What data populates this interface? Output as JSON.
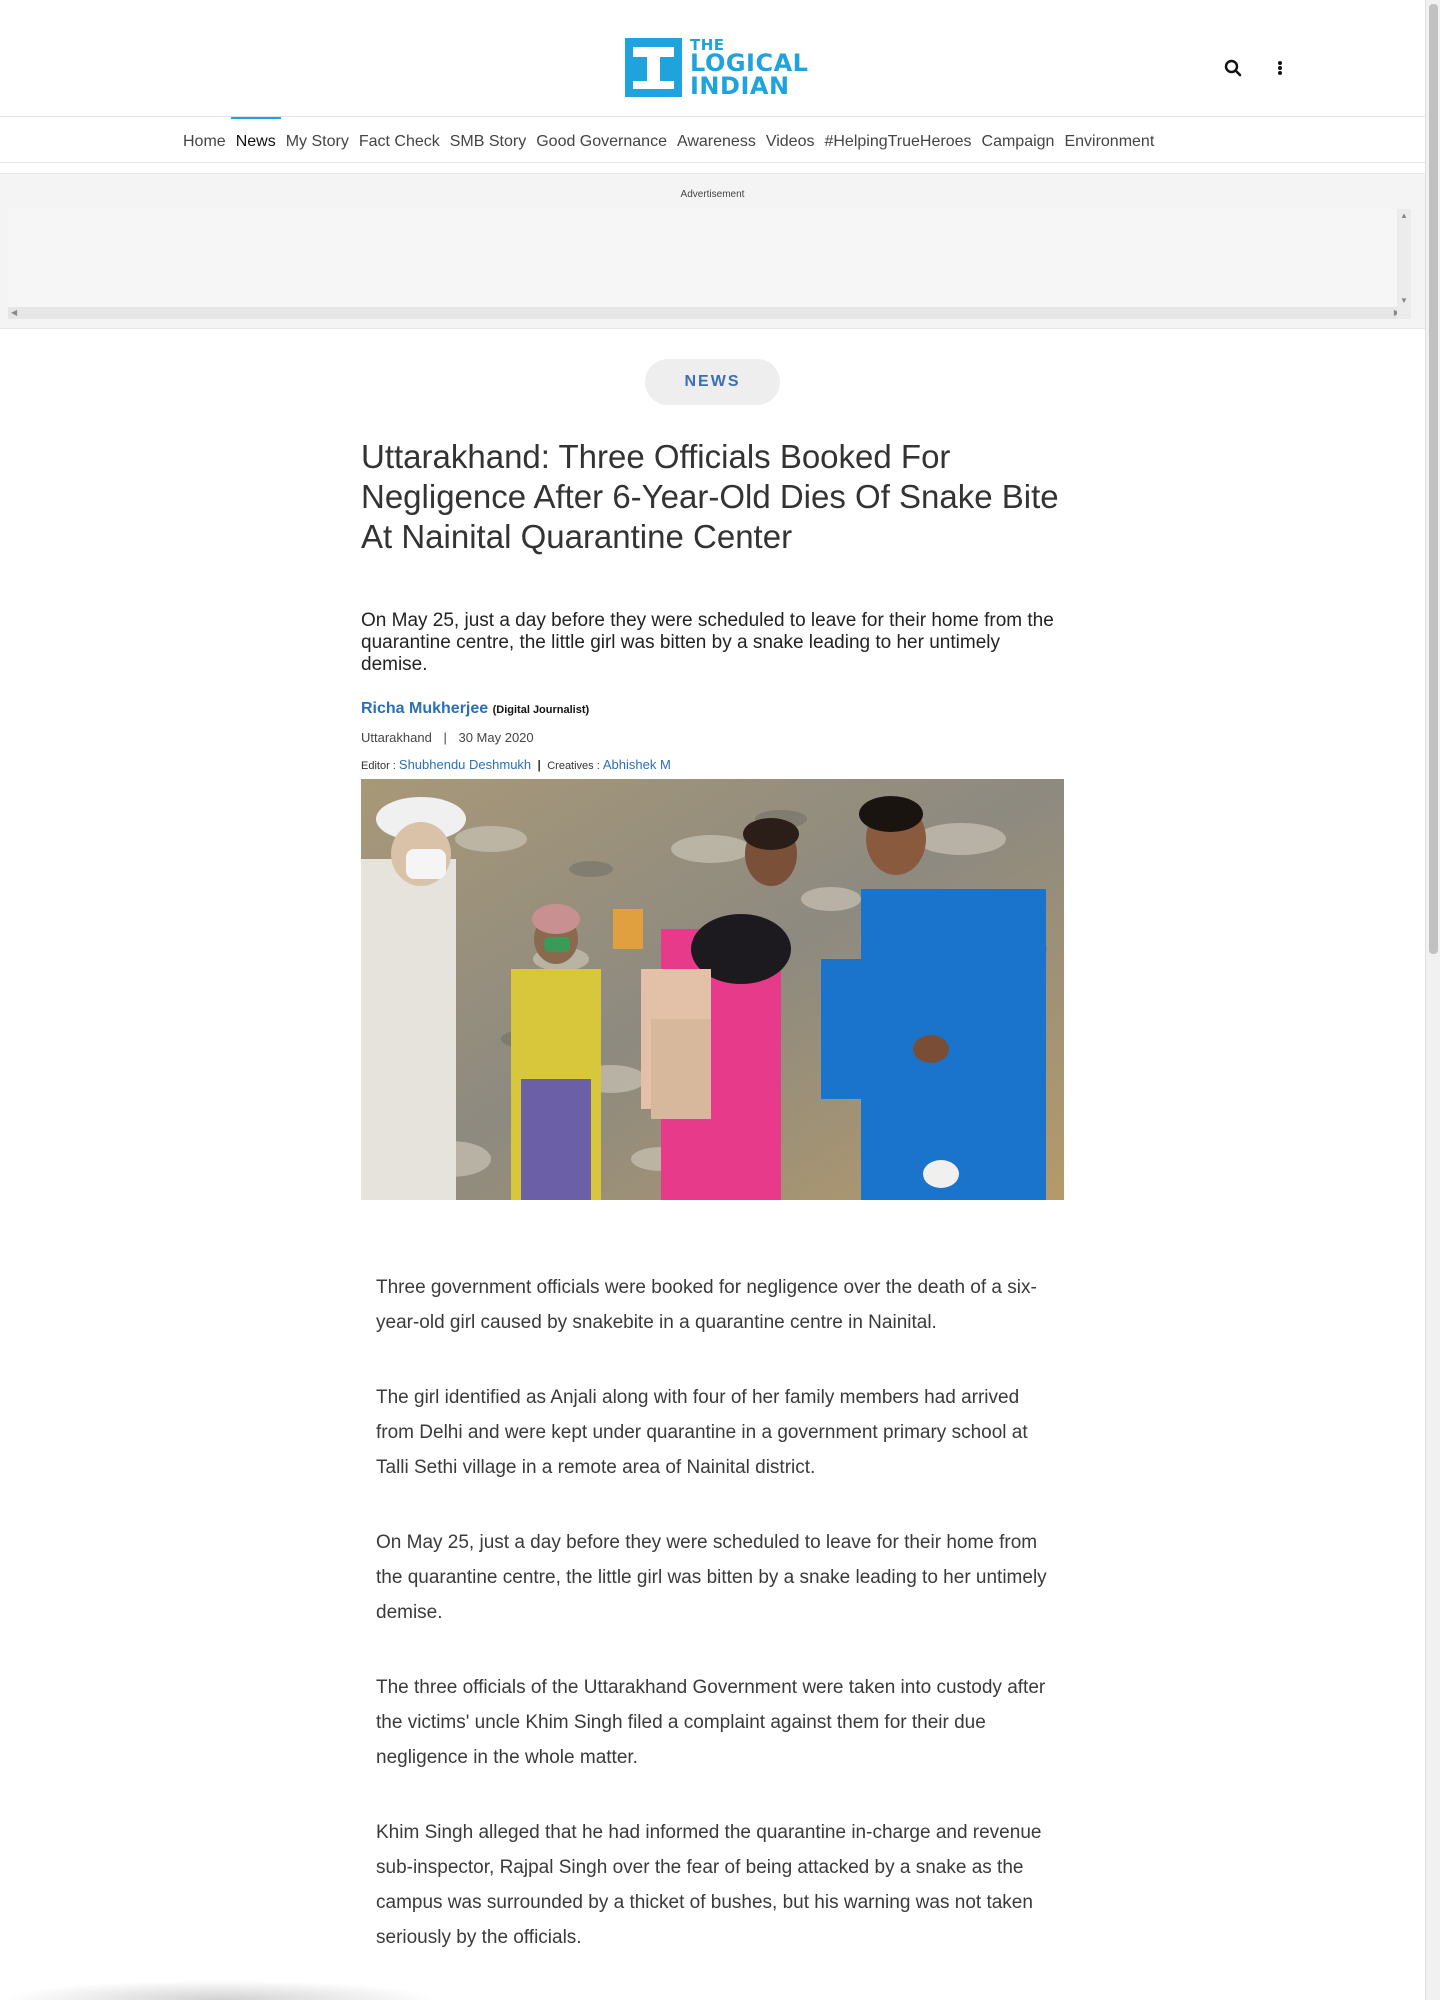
{
  "brand": {
    "logo_line1": "THE",
    "logo_line2": "LOGICAL",
    "logo_line3": "INDIAN",
    "color": "#1fa3dc"
  },
  "header": {
    "search_icon": "search-icon",
    "more_icon": "more-vertical-icon"
  },
  "nav": {
    "items": [
      {
        "label": "Home"
      },
      {
        "label": "News"
      },
      {
        "label": "My Story"
      },
      {
        "label": "Fact Check"
      },
      {
        "label": "SMB Story"
      },
      {
        "label": "Good Governance"
      },
      {
        "label": "Awareness"
      },
      {
        "label": "Videos"
      },
      {
        "label": "#HelpingTrueHeroes"
      },
      {
        "label": "Campaign"
      },
      {
        "label": "Environment"
      }
    ],
    "active": "News"
  },
  "ad": {
    "label": "Advertisement"
  },
  "article": {
    "category": "NEWS",
    "title": "Uttarakhand: Three Officials Booked For Negligence After 6-Year-Old Dies Of Snake Bite At Nainital Quarantine Center",
    "summary": "On May 25, just a day before they were scheduled to leave for their home from the quarantine centre, the little girl was bitten by a snake leading to her untimely demise.",
    "author": "Richa Mukherjee",
    "author_role": "(Digital Journalist)",
    "location": "Uttarakhand",
    "separator": "|",
    "date": "30 May 2020",
    "editor_label": "Editor : ",
    "editor": "Shubhendu Deshmukh",
    "creatives_label": "Creatives : ",
    "creatives": "Abhishek M",
    "paragraphs": [
      "Three government officials were booked for negligence over the death of a six-year-old girl caused by snakebite in a quarantine centre in Nainital.",
      "The girl identified as Anjali along with four of her family members had arrived from Delhi and were kept under quarantine in a government primary school at Talli Sethi village in a remote area of Nainital district.",
      "On May 25, just a day before they were scheduled to leave for their home from the quarantine centre, the little girl was bitten by a snake leading to her untimely demise.",
      "The three officials of the Uttarakhand Government were taken into custody after the victims' uncle Khim Singh filed a complaint against them for their due negligence in the whole matter.",
      "Khim Singh alleged that he had informed the quarantine in-charge and revenue sub-inspector, Rajpal Singh over the fear of being attacked by a snake as the campus was surrounded by a thicket of bushes, but his warning was not taken seriously by the officials."
    ]
  }
}
